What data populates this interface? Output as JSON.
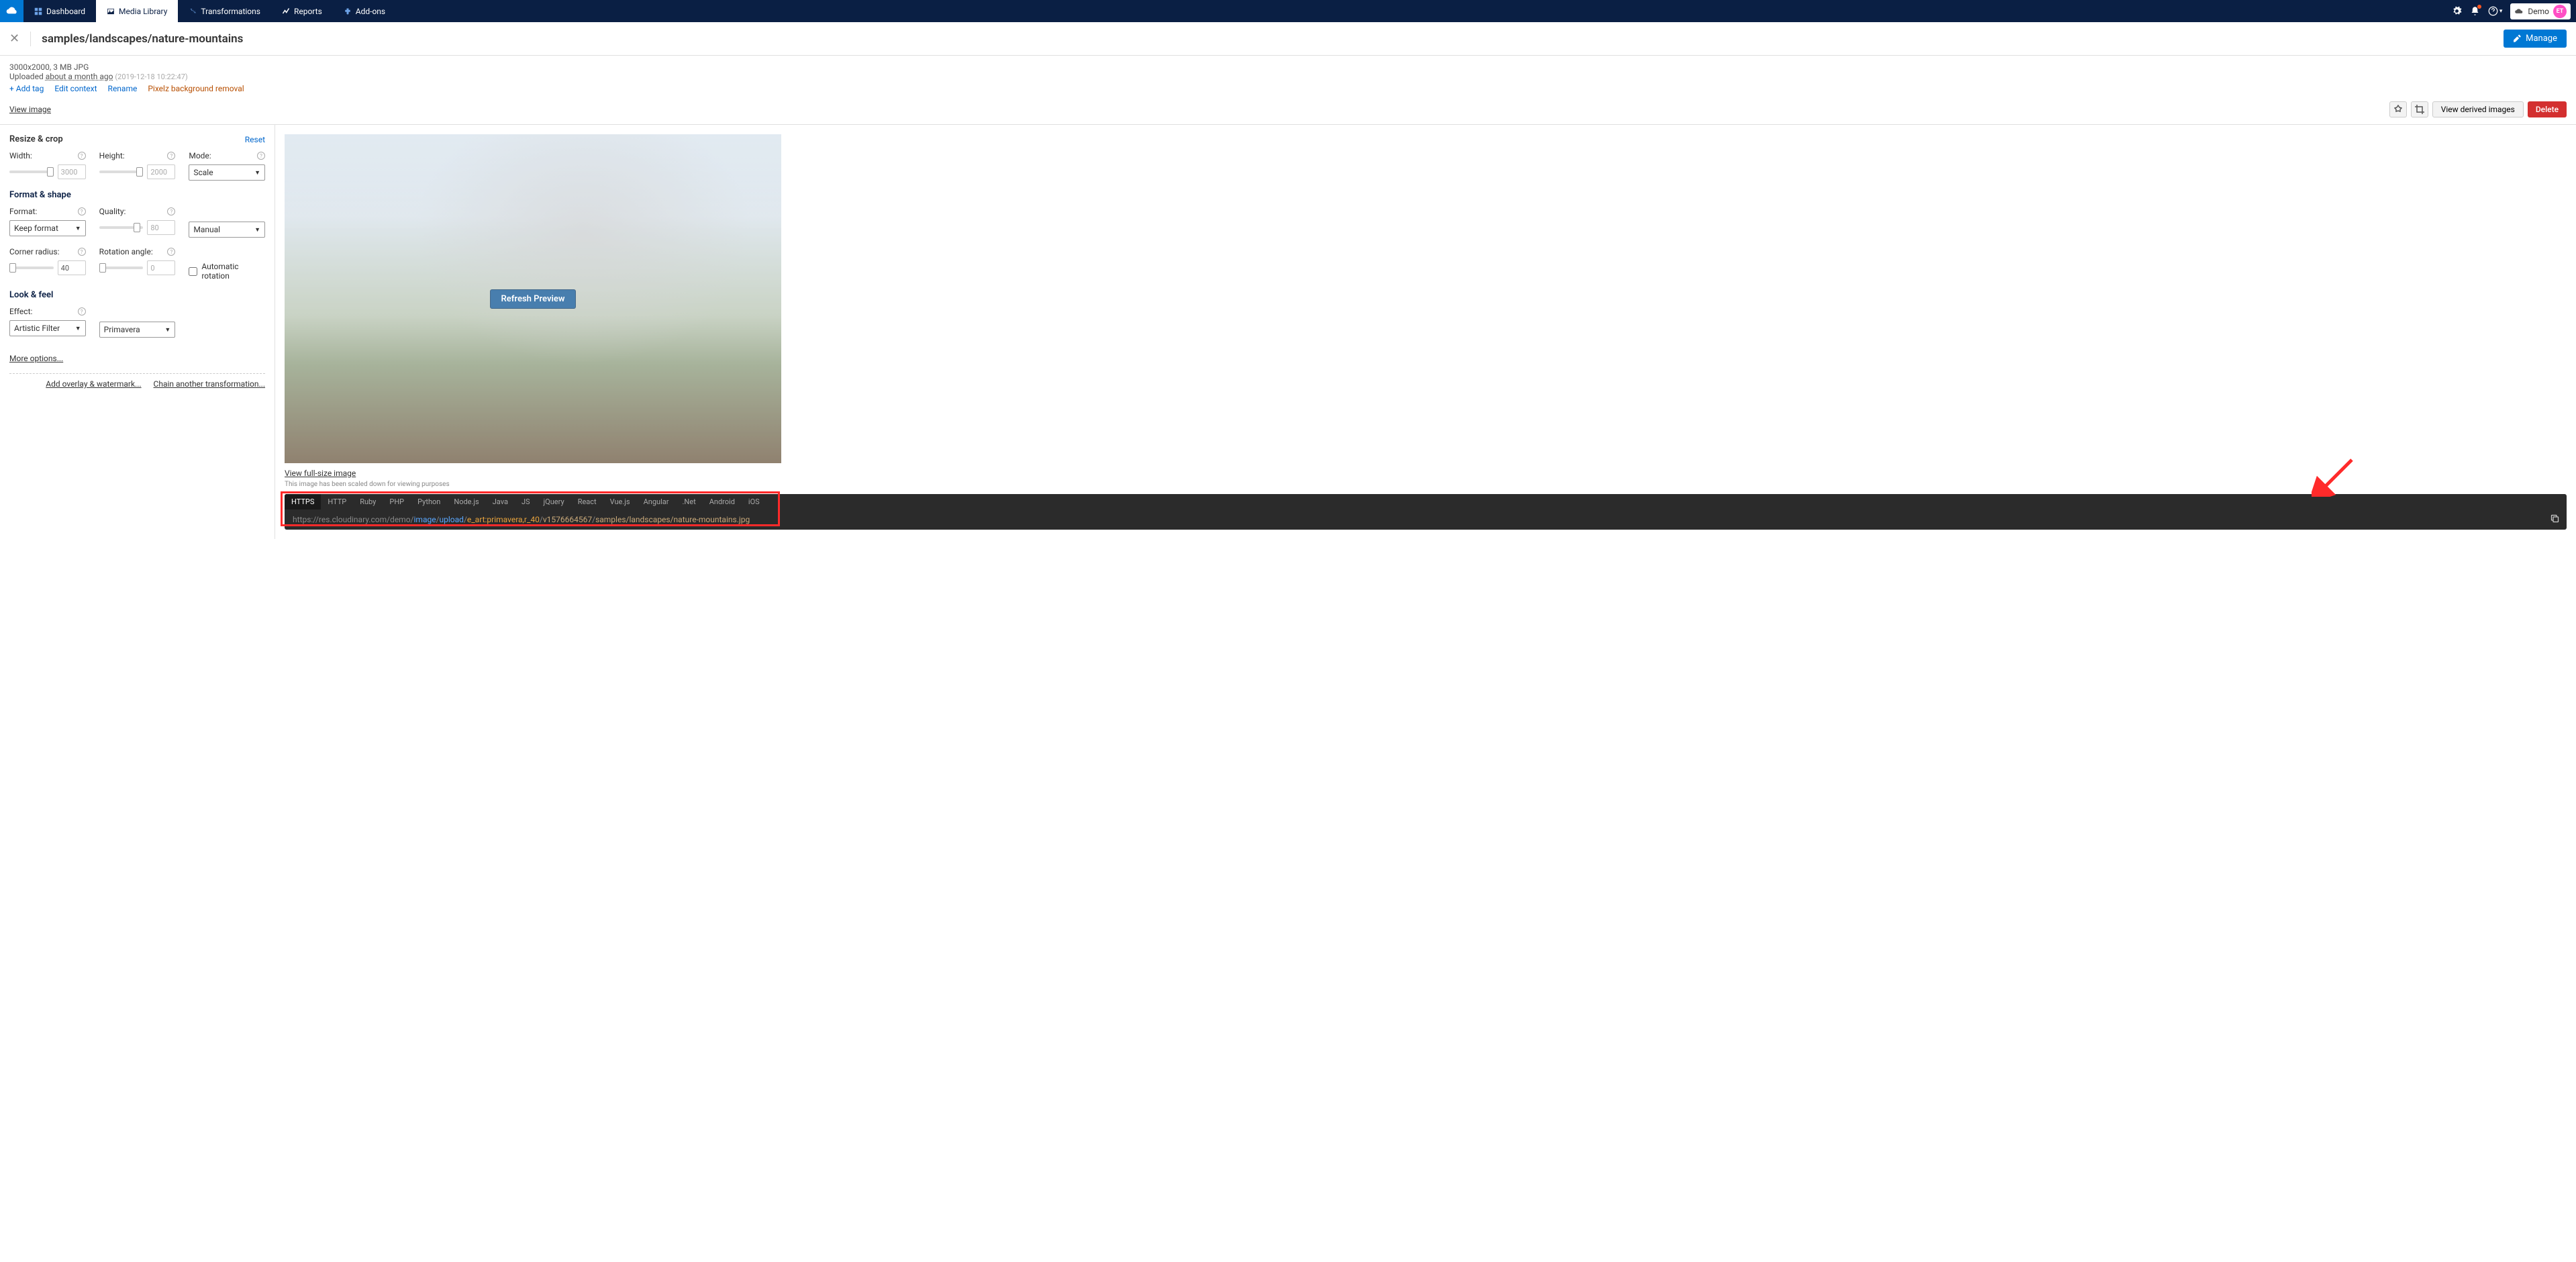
{
  "nav": {
    "items": [
      {
        "label": "Dashboard"
      },
      {
        "label": "Media Library"
      },
      {
        "label": "Transformations"
      },
      {
        "label": "Reports"
      },
      {
        "label": "Add-ons"
      }
    ],
    "account_name": "Demo",
    "avatar_initials": "ET"
  },
  "page": {
    "title": "samples/landscapes/nature-mountains",
    "manage_label": "Manage"
  },
  "meta": {
    "dimensions_line": "3000x2000, 3 MB JPG",
    "uploaded_prefix": "Uploaded ",
    "uploaded_relative": "about a month ago",
    "uploaded_timestamp": "(2019-12-18 10:22:47)",
    "actions": {
      "add_tag": "+ Add tag",
      "edit_context": "Edit context",
      "rename": "Rename",
      "pixelz": "Pixelz background removal"
    },
    "view_image": "View image",
    "view_derived": "View derived images",
    "delete": "Delete"
  },
  "sidebar": {
    "resize_crop": "Resize & crop",
    "reset": "Reset",
    "width_label": "Width:",
    "width_value": "3000",
    "height_label": "Height:",
    "height_value": "2000",
    "mode_label": "Mode:",
    "mode_value": "Scale",
    "format_shape": "Format & shape",
    "format_label": "Format:",
    "format_value": "Keep format",
    "quality_label": "Quality:",
    "quality_value": "80",
    "quality_mode": "Manual",
    "corner_label": "Corner radius:",
    "corner_value": "40",
    "rotation_label": "Rotation angle:",
    "rotation_value": "0",
    "auto_rotation": "Automatic rotation",
    "look_feel": "Look & feel",
    "effect_label": "Effect:",
    "effect_value": "Artistic Filter",
    "effect_option": "Primavera",
    "more_options": "More options...",
    "overlay_link": "Add overlay & watermark...",
    "chain_link": "Chain another transformation..."
  },
  "preview": {
    "refresh": "Refresh Preview",
    "view_full": "View full-size image",
    "scale_note": "This image has been scaled down for viewing purposes"
  },
  "code": {
    "tabs": [
      "HTTPS",
      "HTTP",
      "Ruby",
      "PHP",
      "Python",
      "Node.js",
      "Java",
      "JS",
      "jQuery",
      "React",
      "Vue.js",
      "Angular",
      ".Net",
      "Android",
      "iOS"
    ],
    "url_parts": {
      "base": "https://res.cloudinary.com/demo/",
      "type": "image",
      "sep": "/",
      "action": "upload",
      "transform": "e_art:primavera,r_40",
      "version": "v1576664567",
      "path": "samples/landscapes/nature-mountains.jpg"
    }
  }
}
